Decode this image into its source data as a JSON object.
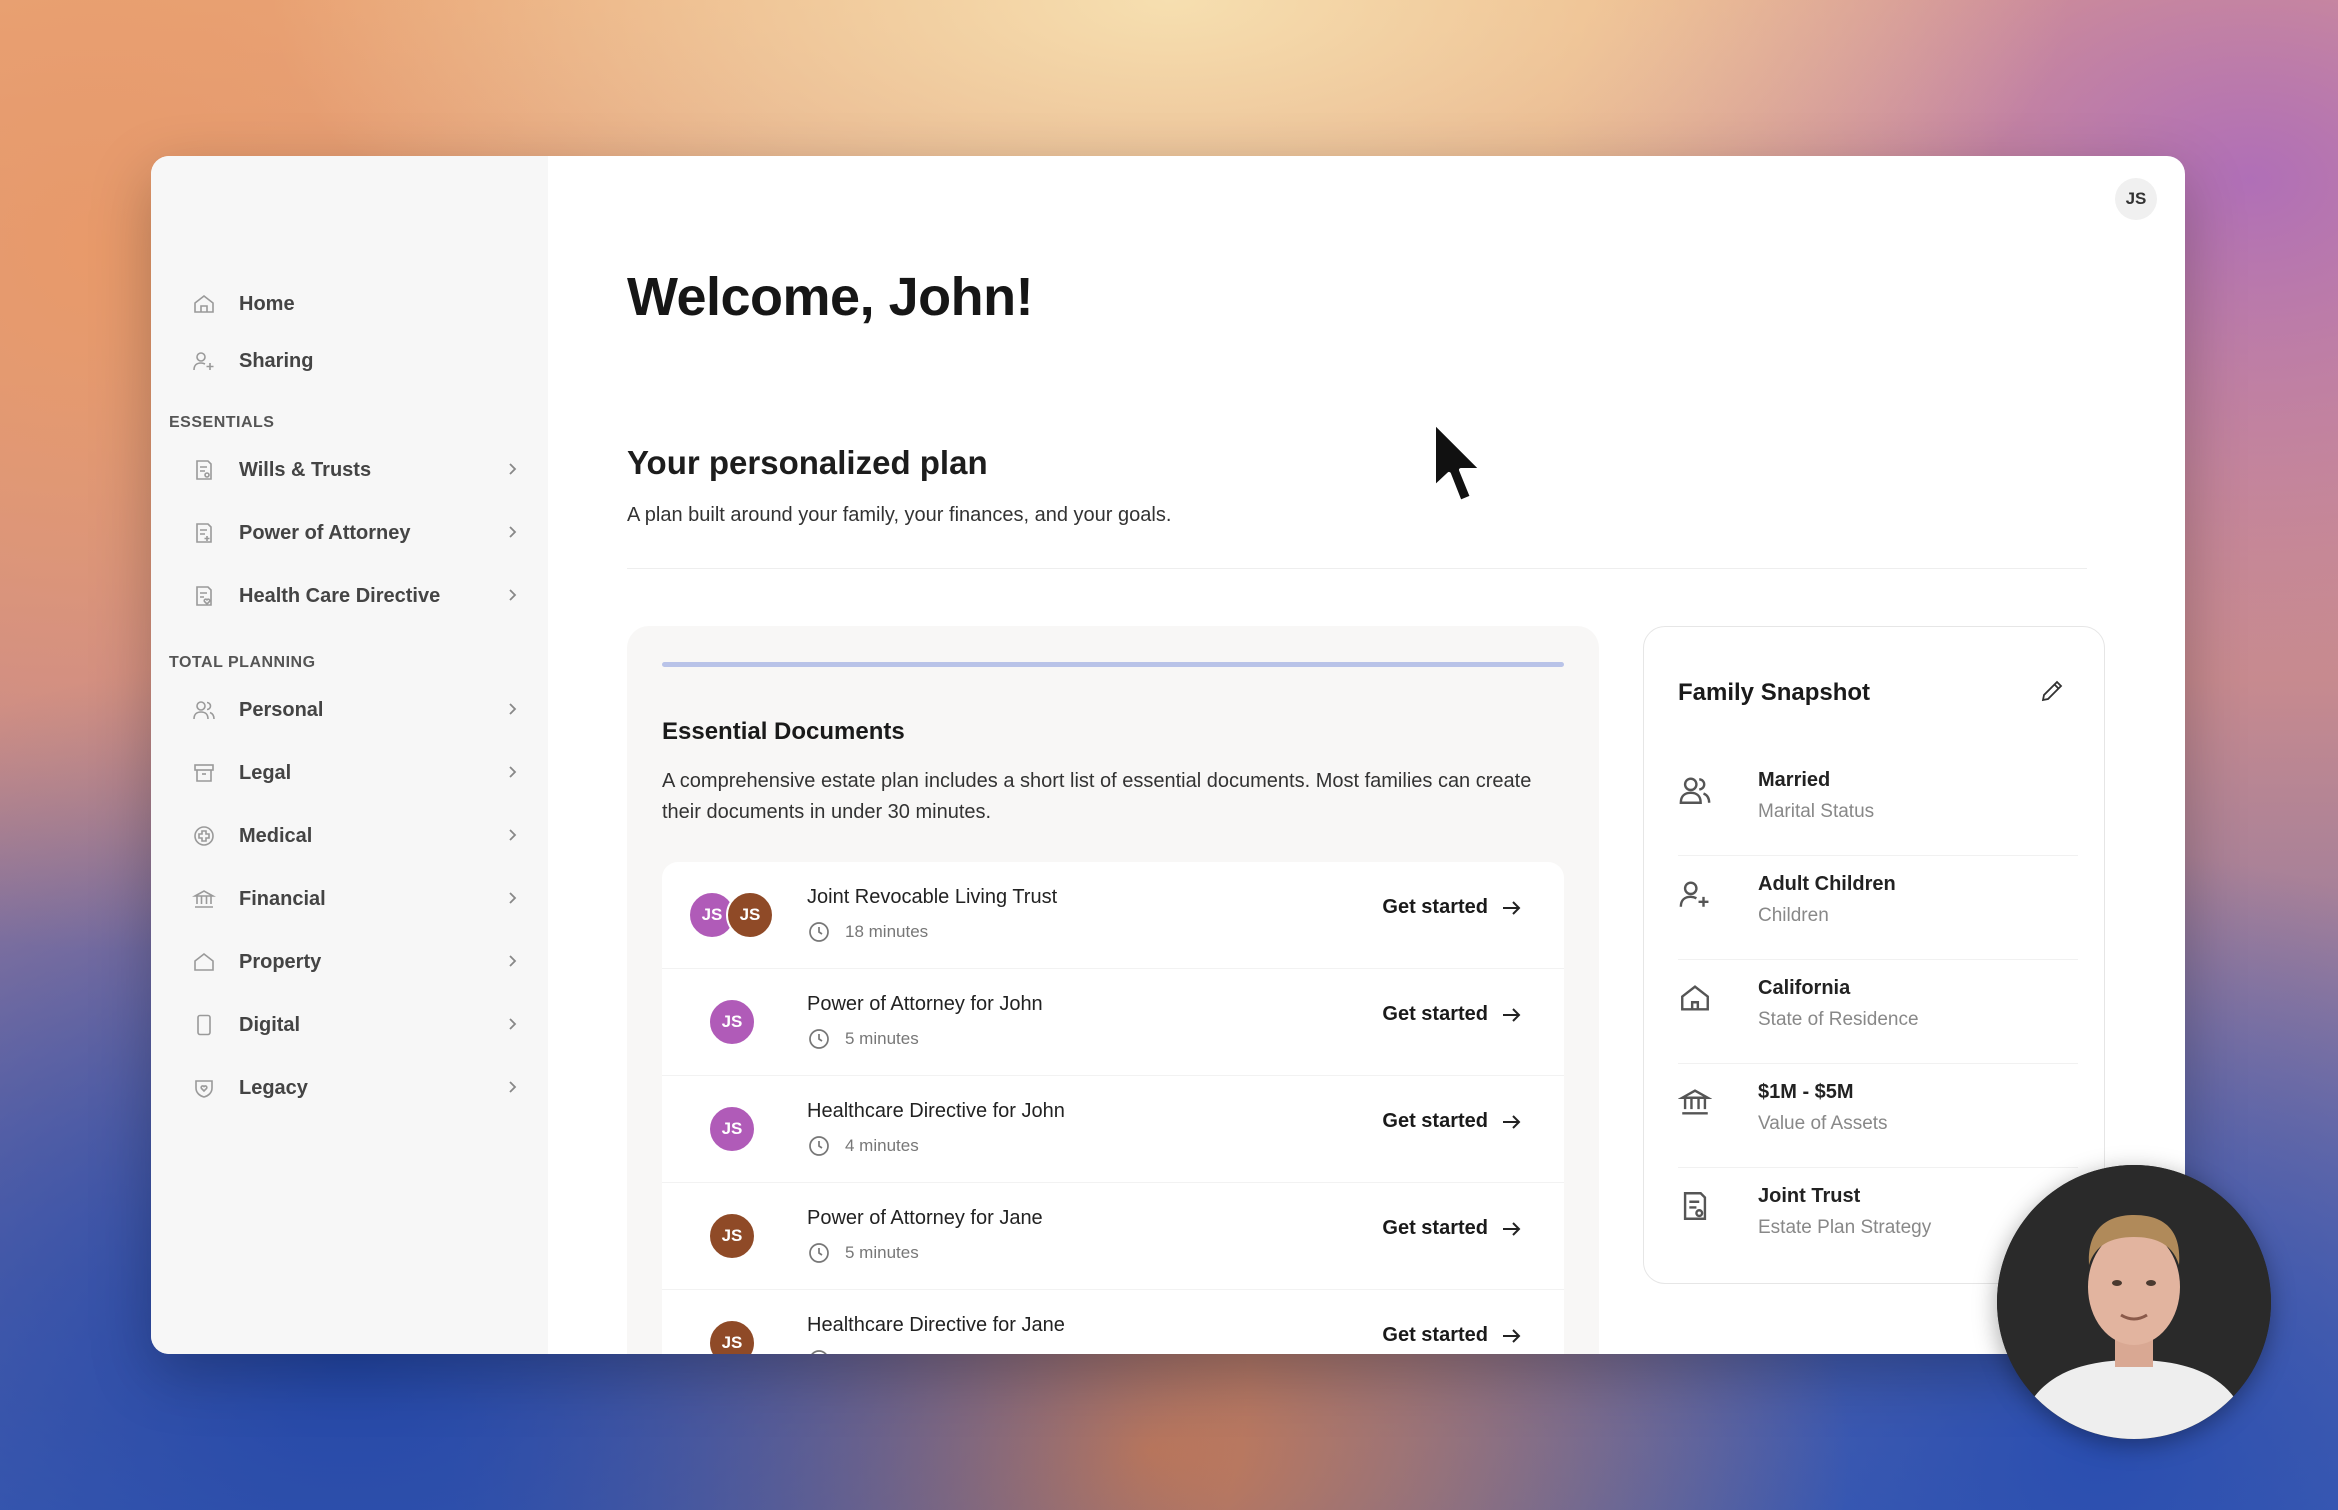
{
  "user": {
    "initials": "JS"
  },
  "sidebar": {
    "items": [
      {
        "label": "Home",
        "icon": "home-icon"
      },
      {
        "label": "Sharing",
        "icon": "user-add-icon"
      }
    ],
    "sections": [
      {
        "label": "ESSENTIALS",
        "items": [
          {
            "label": "Wills & Trusts",
            "icon": "document-icon"
          },
          {
            "label": "Power of Attorney",
            "icon": "document-icon"
          },
          {
            "label": "Health Care Directive",
            "icon": "document-heart-icon"
          }
        ]
      },
      {
        "label": "TOTAL PLANNING",
        "items": [
          {
            "label": "Personal",
            "icon": "users-icon"
          },
          {
            "label": "Legal",
            "icon": "archive-icon"
          },
          {
            "label": "Medical",
            "icon": "medical-icon"
          },
          {
            "label": "Financial",
            "icon": "bank-icon"
          },
          {
            "label": "Property",
            "icon": "home-icon"
          },
          {
            "label": "Digital",
            "icon": "phone-icon"
          },
          {
            "label": "Legacy",
            "icon": "heart-shield-icon"
          }
        ]
      }
    ]
  },
  "main": {
    "welcome": "Welcome, John!",
    "plan_title": "Your personalized plan",
    "plan_subtitle": "A plan built around your family, your finances, and your goals."
  },
  "essential_docs": {
    "title": "Essential Documents",
    "description": "A comprehensive estate plan includes a short list of essential documents. Most families can create their documents in under 30 minutes.",
    "action_label": "Get started",
    "items": [
      {
        "title": "Joint Revocable Living Trust",
        "time": "18 minutes",
        "avatars": [
          "JS",
          "JS"
        ]
      },
      {
        "title": "Power of Attorney for John",
        "time": "5 minutes",
        "avatars": [
          "JS"
        ]
      },
      {
        "title": "Healthcare Directive for John",
        "time": "4 minutes",
        "avatars": [
          "JS"
        ]
      },
      {
        "title": "Power of Attorney for Jane",
        "time": "5 minutes",
        "avatars": [
          "JS"
        ]
      },
      {
        "title": "Healthcare Directive for Jane",
        "time": "",
        "avatars": [
          "JS"
        ]
      }
    ]
  },
  "family_snapshot": {
    "title": "Family Snapshot",
    "items": [
      {
        "value": "Married",
        "label": "Marital Status",
        "icon": "users-icon"
      },
      {
        "value": "Adult Children",
        "label": "Children",
        "icon": "user-add-icon"
      },
      {
        "value": "California",
        "label": "State of Residence",
        "icon": "home-icon"
      },
      {
        "value": "$1M - $5M",
        "label": "Value of Assets",
        "icon": "bank-icon"
      },
      {
        "value": "Joint Trust",
        "label": "Estate Plan Strategy",
        "icon": "document-icon"
      }
    ]
  },
  "colors": {
    "avatar_john": "#b05bb8",
    "avatar_jane": "#8f4a27",
    "progress": "#b9c3e8"
  }
}
